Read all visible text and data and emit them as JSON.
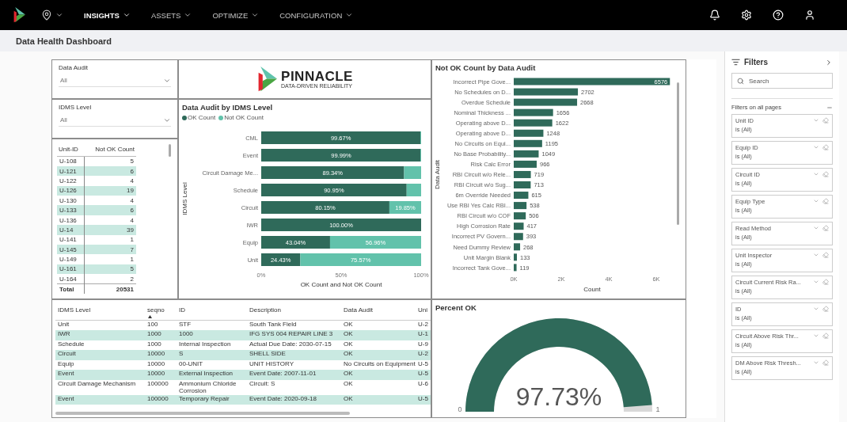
{
  "nav": {
    "items": [
      {
        "label": "INSIGHTS",
        "selected": true
      },
      {
        "label": "ASSETS",
        "selected": false
      },
      {
        "label": "OPTIMIZE",
        "selected": false
      },
      {
        "label": "CONFIGURATION",
        "selected": false
      }
    ]
  },
  "page_title": "Data Health Dashboard",
  "slicers": [
    {
      "title": "Data Audit",
      "value": "All"
    },
    {
      "title": "IDMS Level",
      "value": "All"
    }
  ],
  "logo": {
    "name": "PINNACLE",
    "tagline": "DATA-DRIVEN RELIABILITY"
  },
  "unit_table": {
    "columns": [
      "Unit-ID",
      "Not OK Count"
    ],
    "rows": [
      [
        "U-108",
        "5"
      ],
      [
        "U-121",
        "6"
      ],
      [
        "U-122",
        "4"
      ],
      [
        "U-126",
        "19"
      ],
      [
        "U-130",
        "4"
      ],
      [
        "U-133",
        "6"
      ],
      [
        "U-136",
        "4"
      ],
      [
        "U-14",
        "39"
      ],
      [
        "U-141",
        "1"
      ],
      [
        "U-145",
        "7"
      ],
      [
        "U-149",
        "1"
      ],
      [
        "U-161",
        "5"
      ],
      [
        "U-164",
        "2"
      ]
    ],
    "total": [
      "Total",
      "20531"
    ]
  },
  "audit_chart": {
    "chart_data": {
      "type": "bar",
      "orientation": "horizontal",
      "stacked": true,
      "title": "Data Audit by IDMS Level",
      "xlabel": "OK Count and Not OK Count",
      "ylabel": "IDMS Level",
      "categories": [
        "CML",
        "Event",
        "Circuit Damage Me...",
        "Schedule",
        "Circuit",
        "IWR",
        "Equip",
        "Unit"
      ],
      "series": [
        {
          "name": "OK Count",
          "color": "#2f6a5a",
          "values": [
            99.67,
            99.99,
            89.34,
            90.95,
            80.15,
            100,
            43.04,
            24.43
          ],
          "value_labels": [
            "99.67%",
            "99.99%",
            "89.34%",
            "90.95%",
            "80.15%",
            "100.00%",
            "43.04%",
            "24.43%"
          ]
        },
        {
          "name": "Not OK Count",
          "color": "#62c2ab",
          "values": [
            0.33,
            0.01,
            10.66,
            9.05,
            19.85,
            0,
            56.96,
            75.57
          ],
          "value_labels": [
            null,
            null,
            null,
            null,
            "19.85%",
            null,
            "56.96%",
            "75.57%"
          ]
        }
      ],
      "xlim": [
        0,
        100
      ],
      "xticks": [
        {
          "value": 0,
          "label": "0%"
        },
        {
          "value": 50,
          "label": "50%"
        },
        {
          "value": 100,
          "label": "100%"
        }
      ]
    }
  },
  "not_ok_chart": {
    "chart_data": {
      "type": "bar",
      "orientation": "horizontal",
      "title": "Not OK Count by Data Audit",
      "xlabel": "Count",
      "ylabel": "Data Audit",
      "categories": [
        "Incorrect Pipe Gove...",
        "No Schedules on D...",
        "Overdue Schedule",
        "Nominal Thickness ...",
        "Operating above D...",
        "Operating above D...",
        "No Circuits on Equi...",
        "No Base Probability...",
        "Risk Calc Error",
        "RBI Circuit w/o Rele...",
        "RBI Circuit w/o Sug...",
        "6m Override Needed",
        "Use RBI Yes Calc RBI...",
        "RBI Circuit w/o COF",
        "High Corrosion Rate",
        "Incorrect PV Govern...",
        "Need Dummy Review",
        "Unit Margin Blank",
        "Incorrect Tank Gove..."
      ],
      "series": [
        {
          "color": "#2f6a5a",
          "values": [
            6576,
            2702,
            2668,
            1656,
            1622,
            1248,
            1195,
            1049,
            966,
            719,
            713,
            615,
            538,
            506,
            417,
            393,
            268,
            133,
            119
          ]
        }
      ],
      "xlim": [
        0,
        6600
      ],
      "xticks": [
        {
          "value": 0,
          "label": "0K"
        },
        {
          "value": 2000,
          "label": "2K"
        },
        {
          "value": 4000,
          "label": "4K"
        },
        {
          "value": 6000,
          "label": "6K"
        }
      ],
      "data_labels": true
    }
  },
  "detail_table": {
    "columns": [
      {
        "label": "IDMS Level",
        "sorted": false
      },
      {
        "label": "seqno",
        "sorted": true
      },
      {
        "label": "ID",
        "sorted": false
      },
      {
        "label": "Description",
        "sorted": false
      },
      {
        "label": "Data Audit",
        "sorted": false
      },
      {
        "label": "Uni",
        "sorted": false
      }
    ],
    "rows": [
      [
        "Unit",
        "100",
        "STF",
        "South Tank Field",
        "OK",
        "U-2"
      ],
      [
        "IWR",
        "1000",
        "1000",
        "IFG SYS 004 REPAIR LINE 3",
        "OK",
        "U-1"
      ],
      [
        "Schedule",
        "1000",
        "Internal Inspection",
        "Actual Due Date: 2030-07-15",
        "OK",
        "U-9"
      ],
      [
        "Circuit",
        "10000",
        "S",
        "SHELL SIDE",
        "OK",
        "U-2"
      ],
      [
        "Equip",
        "10000",
        "00-UNIT",
        "UNIT HISTORY",
        "No Circuits on Equipment",
        "U-5"
      ],
      [
        "Event",
        "10000",
        "External Inspection",
        "Event Date: 2007-11-01",
        "OK",
        "U-5"
      ],
      [
        "Circuit Damage Mechanism",
        "100000",
        "Ammonium Chloride Corrosion",
        "Circuit: S",
        "OK",
        "U-6"
      ],
      [
        "Event",
        "100000",
        "Temporary Repair",
        "Event Date: 2020-09-18",
        "OK",
        "U-5"
      ]
    ]
  },
  "gauge": {
    "title": "Percent OK",
    "level": 0.9773,
    "reading": "97.73%",
    "min": "0",
    "max": "1"
  },
  "filters": {
    "title": "Filters",
    "search_placeholder": "Search",
    "section": "Filters on all pages",
    "items": [
      {
        "name": "Unit ID",
        "value": "is (All)"
      },
      {
        "name": "Equip ID",
        "value": "is (All)"
      },
      {
        "name": "Circuit ID",
        "value": "is (All)"
      },
      {
        "name": "Equip Type",
        "value": "is (All)"
      },
      {
        "name": "Read Method",
        "value": "is (All)"
      },
      {
        "name": "Unit Inspector",
        "value": "is (All)"
      },
      {
        "name": "Circuit Current Risk Ra...",
        "value": "is (All)"
      },
      {
        "name": "ID",
        "value": "is (All)"
      },
      {
        "name": "Circuit Above Risk Thr...",
        "value": "is (All)"
      },
      {
        "name": "DM Above Risk Thresh...",
        "value": "is (All)"
      }
    ]
  }
}
